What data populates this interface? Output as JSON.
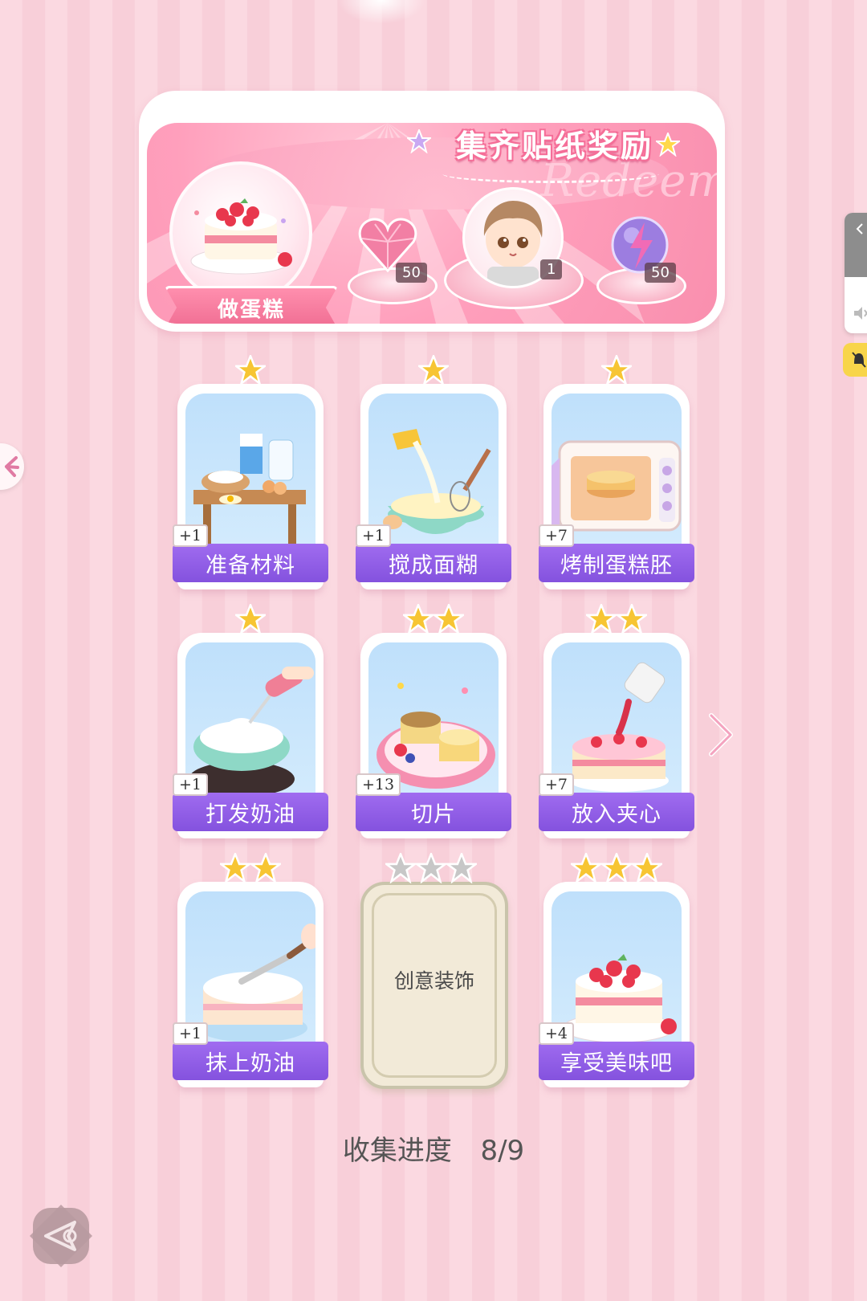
{
  "banner": {
    "title": "集齐贴纸奖励",
    "watermark": "Redeem",
    "theme_label": "做蛋糕",
    "rewards": [
      {
        "icon": "pink-heart-gem-icon",
        "count": "50"
      },
      {
        "icon": "chibi-avatar-icon",
        "count": "1"
      },
      {
        "icon": "purple-lightning-orb-icon",
        "count": "50"
      }
    ]
  },
  "cards": [
    {
      "label": "准备材料",
      "badge": "+1",
      "stars": 1,
      "icon": "ingredients-table-icon"
    },
    {
      "label": "搅成面糊",
      "badge": "+1",
      "stars": 1,
      "icon": "batter-bowl-icon"
    },
    {
      "label": "烤制蛋糕胚",
      "badge": "+7",
      "stars": 1,
      "icon": "oven-icon"
    },
    {
      "label": "打发奶油",
      "badge": "+1",
      "stars": 1,
      "icon": "whip-cream-mixer-icon"
    },
    {
      "label": "切片",
      "badge": "+13",
      "stars": 2,
      "icon": "sliced-sponge-icon"
    },
    {
      "label": "放入夹心",
      "badge": "+7",
      "stars": 2,
      "icon": "jam-filling-cake-icon"
    },
    {
      "label": "抹上奶油",
      "badge": "+1",
      "stars": 2,
      "icon": "frosting-cake-icon"
    },
    {
      "label": "创意装饰",
      "badge": "",
      "stars": 3,
      "locked": true,
      "icon": "locked-card-icon"
    },
    {
      "label": "享受美味吧",
      "badge": "+4",
      "stars": 3,
      "icon": "strawberry-cake-icon"
    }
  ],
  "progress": {
    "label": "收集进度",
    "value": "8/9"
  },
  "colors": {
    "card_label": "#8452de",
    "star_gold": "#f7c533",
    "star_gray": "#c7c7c7",
    "banner_pink": "#f98fae"
  }
}
